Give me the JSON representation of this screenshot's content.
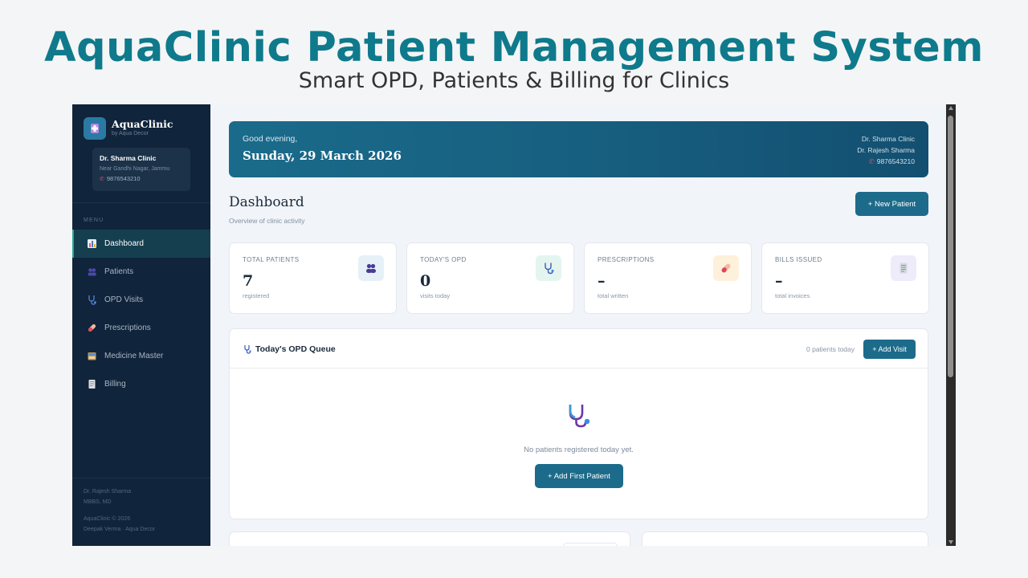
{
  "promo": {
    "title": "AquaClinic Patient Management System",
    "subtitle": "Smart OPD, Patients & Billing for Clinics"
  },
  "sidebar": {
    "brand_name": "AquaClinic",
    "brand_by": "by Aqua Decor",
    "clinic": {
      "name": "Dr. Sharma Clinic",
      "address": "Near Gandhi Nagar, Jammu",
      "phone": "9876543210"
    },
    "menu_label": "MENU",
    "items": [
      {
        "label": "Dashboard",
        "icon": "chart-icon",
        "active": true
      },
      {
        "label": "Patients",
        "icon": "users-icon",
        "active": false
      },
      {
        "label": "OPD Visits",
        "icon": "stethoscope-icon",
        "active": false
      },
      {
        "label": "Prescriptions",
        "icon": "pill-icon",
        "active": false
      },
      {
        "label": "Medicine Master",
        "icon": "cabinet-icon",
        "active": false
      },
      {
        "label": "Billing",
        "icon": "receipt-icon",
        "active": false
      }
    ],
    "footer": {
      "doctor": "Dr. Rajesh Sharma",
      "degree": "MBBS, MD",
      "copyright": "AquaClinic © 2026",
      "credit": "Deepak Verma · Aqua Decor"
    }
  },
  "banner": {
    "greeting": "Good evening,",
    "date": "Sunday, 29 March 2026",
    "clinic": "Dr. Sharma Clinic",
    "doctor": "Dr. Rajesh Sharma",
    "phone": "9876543210"
  },
  "dashboard": {
    "title": "Dashboard",
    "subtitle": "Overview of clinic activity",
    "new_patient_label": "+ New Patient"
  },
  "stats": [
    {
      "label": "TOTAL PATIENTS",
      "value": "7",
      "note": "registered",
      "icon": "users-icon",
      "bg": "#e6f1f7"
    },
    {
      "label": "TODAY'S OPD",
      "value": "0",
      "note": "visits today",
      "icon": "stethoscope-icon",
      "bg": "#e4f5f0"
    },
    {
      "label": "PRESCRIPTIONS",
      "value": "–",
      "note": "total written",
      "icon": "pill-icon",
      "bg": "#fdf1dc"
    },
    {
      "label": "BILLS ISSUED",
      "value": "–",
      "note": "total invoices",
      "icon": "receipt-icon",
      "bg": "#eeecfb"
    }
  ],
  "queue": {
    "title": "Today's OPD Queue",
    "count": "0 patients today",
    "add_visit_label": "+ Add Visit",
    "empty_text": "No patients registered today yet.",
    "add_first_label": "+ Add First Patient"
  },
  "colors": {
    "primary": "#1c6b8b",
    "sidebar": "#10243b",
    "title": "#0e7a8c"
  }
}
